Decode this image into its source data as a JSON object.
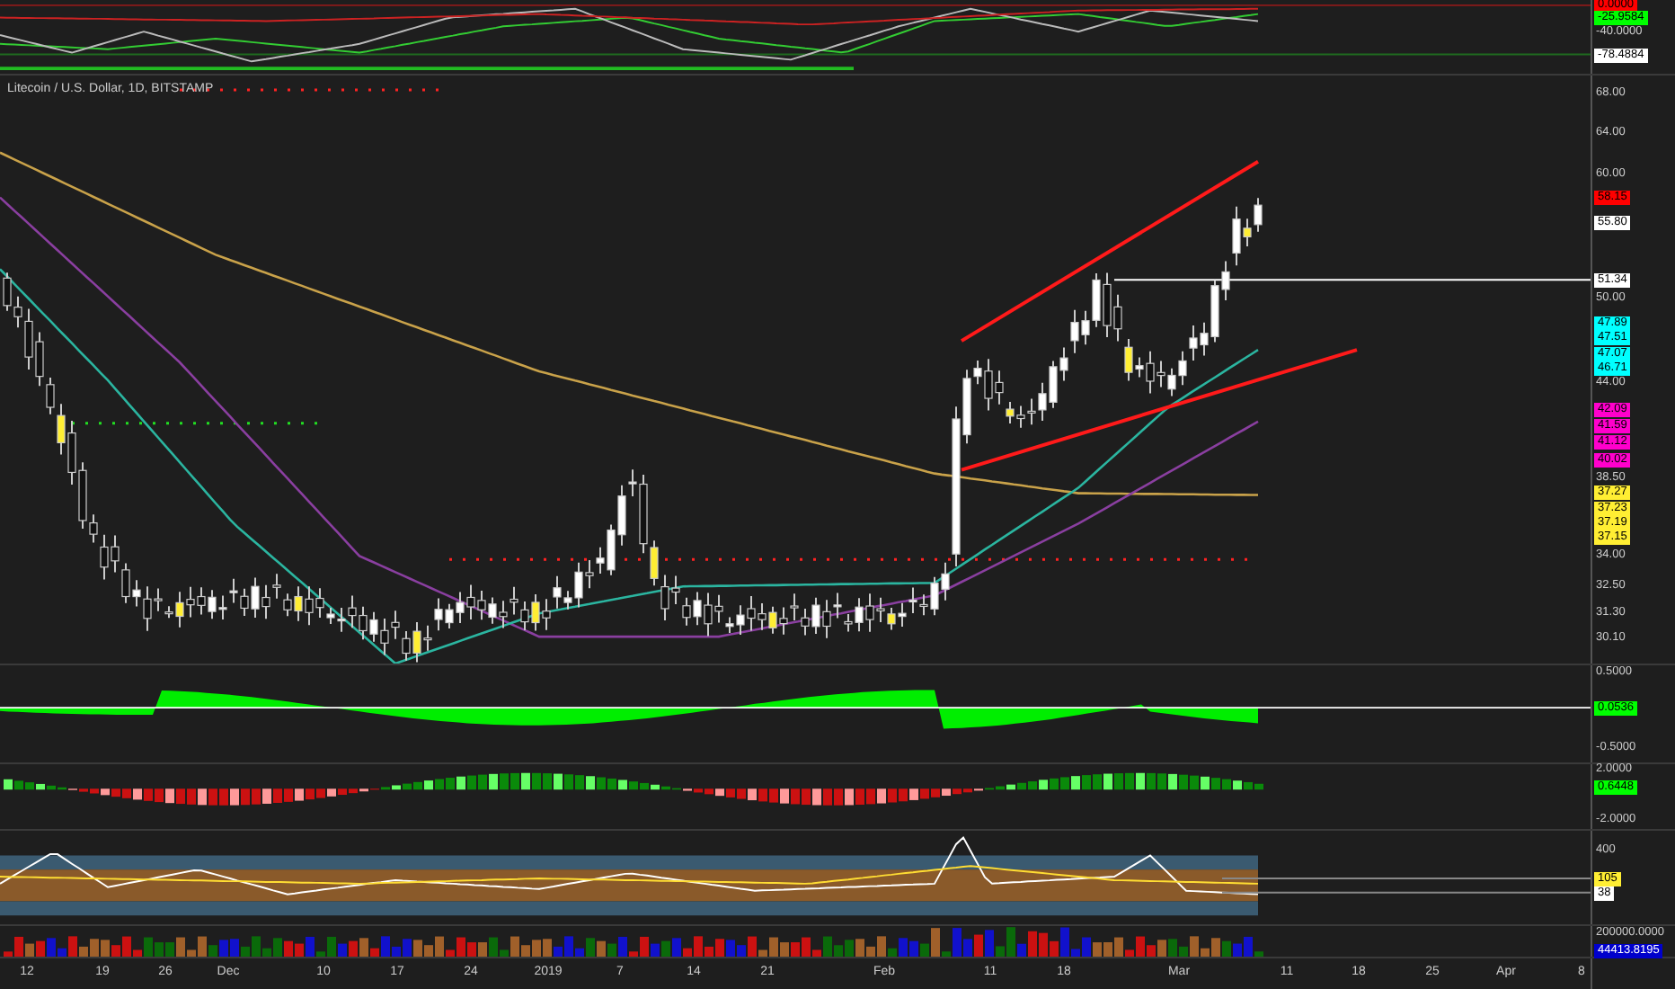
{
  "title": "Litecoin / U.S. Dollar, 1D, BITSTAMP",
  "panes": [
    {
      "kind": "oscillator",
      "labels": [
        {
          "text": "0.0000",
          "kind": "badge",
          "color": "#ff0000"
        },
        {
          "text": "-25.9584",
          "kind": "badge",
          "color": "#00ff00"
        },
        {
          "text": "-40.0000",
          "kind": "tick"
        },
        {
          "text": "-78.4884",
          "kind": "badge",
          "color": "#ffffff"
        }
      ]
    },
    {
      "kind": "price",
      "labels": [
        {
          "text": "68.00",
          "kind": "tick"
        },
        {
          "text": "64.00",
          "kind": "tick"
        },
        {
          "text": "60.00",
          "kind": "tick"
        },
        {
          "text": "58.15",
          "kind": "badge",
          "color": "#ff0000"
        },
        {
          "text": "55.80",
          "kind": "badge",
          "color": "#ffffff"
        },
        {
          "text": "51.34",
          "kind": "badge",
          "color": "#ffffff"
        },
        {
          "text": "50.00",
          "kind": "tick"
        },
        {
          "text": "47.89",
          "kind": "badge",
          "color": "#00ffff"
        },
        {
          "text": "47.51",
          "kind": "badge",
          "color": "#00ffff"
        },
        {
          "text": "47.07",
          "kind": "badge",
          "color": "#00ffff"
        },
        {
          "text": "46.71",
          "kind": "badge",
          "color": "#00ffff"
        },
        {
          "text": "44.00",
          "kind": "tick"
        },
        {
          "text": "42.09",
          "kind": "badge",
          "color": "#ff00cc"
        },
        {
          "text": "41.59",
          "kind": "badge",
          "color": "#ff00cc"
        },
        {
          "text": "41.12",
          "kind": "badge",
          "color": "#ff00cc"
        },
        {
          "text": "40.02",
          "kind": "badge",
          "color": "#ff00cc"
        },
        {
          "text": "38.50",
          "kind": "tick"
        },
        {
          "text": "37.27",
          "kind": "badge",
          "color": "#ffee33"
        },
        {
          "text": "37.23",
          "kind": "badge",
          "color": "#ffee33"
        },
        {
          "text": "37.19",
          "kind": "badge",
          "color": "#ffee33"
        },
        {
          "text": "37.15",
          "kind": "badge",
          "color": "#ffee33"
        },
        {
          "text": "34.00",
          "kind": "tick"
        },
        {
          "text": "32.50",
          "kind": "tick"
        },
        {
          "text": "31.30",
          "kind": "tick"
        },
        {
          "text": "30.10",
          "kind": "tick"
        }
      ]
    },
    {
      "kind": "area",
      "labels": [
        {
          "text": "0.5000",
          "kind": "tick"
        },
        {
          "text": "0.0536",
          "kind": "badge",
          "color": "#00ff00"
        },
        {
          "text": "-0.5000",
          "kind": "tick"
        }
      ]
    },
    {
      "kind": "histogram",
      "labels": [
        {
          "text": "2.0000",
          "kind": "tick"
        },
        {
          "text": "0.6448",
          "kind": "badge",
          "color": "#00ff00"
        },
        {
          "text": "-2.0000",
          "kind": "tick"
        }
      ]
    },
    {
      "kind": "band",
      "labels": [
        {
          "text": "400",
          "kind": "tick"
        },
        {
          "text": "105",
          "kind": "badge",
          "color": "#ffee33"
        },
        {
          "text": "38",
          "kind": "badge",
          "color": "#ffffff"
        }
      ]
    },
    {
      "kind": "volume",
      "labels": [
        {
          "text": "200000.0000",
          "kind": "tick"
        },
        {
          "text": "44413.8195",
          "kind": "badge",
          "color": "#0000cc"
        }
      ]
    }
  ],
  "x_axis": [
    "12",
    "19",
    "26",
    "Dec",
    "10",
    "17",
    "24",
    "2019",
    "7",
    "14",
    "21",
    "Feb",
    "11",
    "18",
    "Mar",
    "11",
    "18",
    "25",
    "Apr",
    "8"
  ]
}
